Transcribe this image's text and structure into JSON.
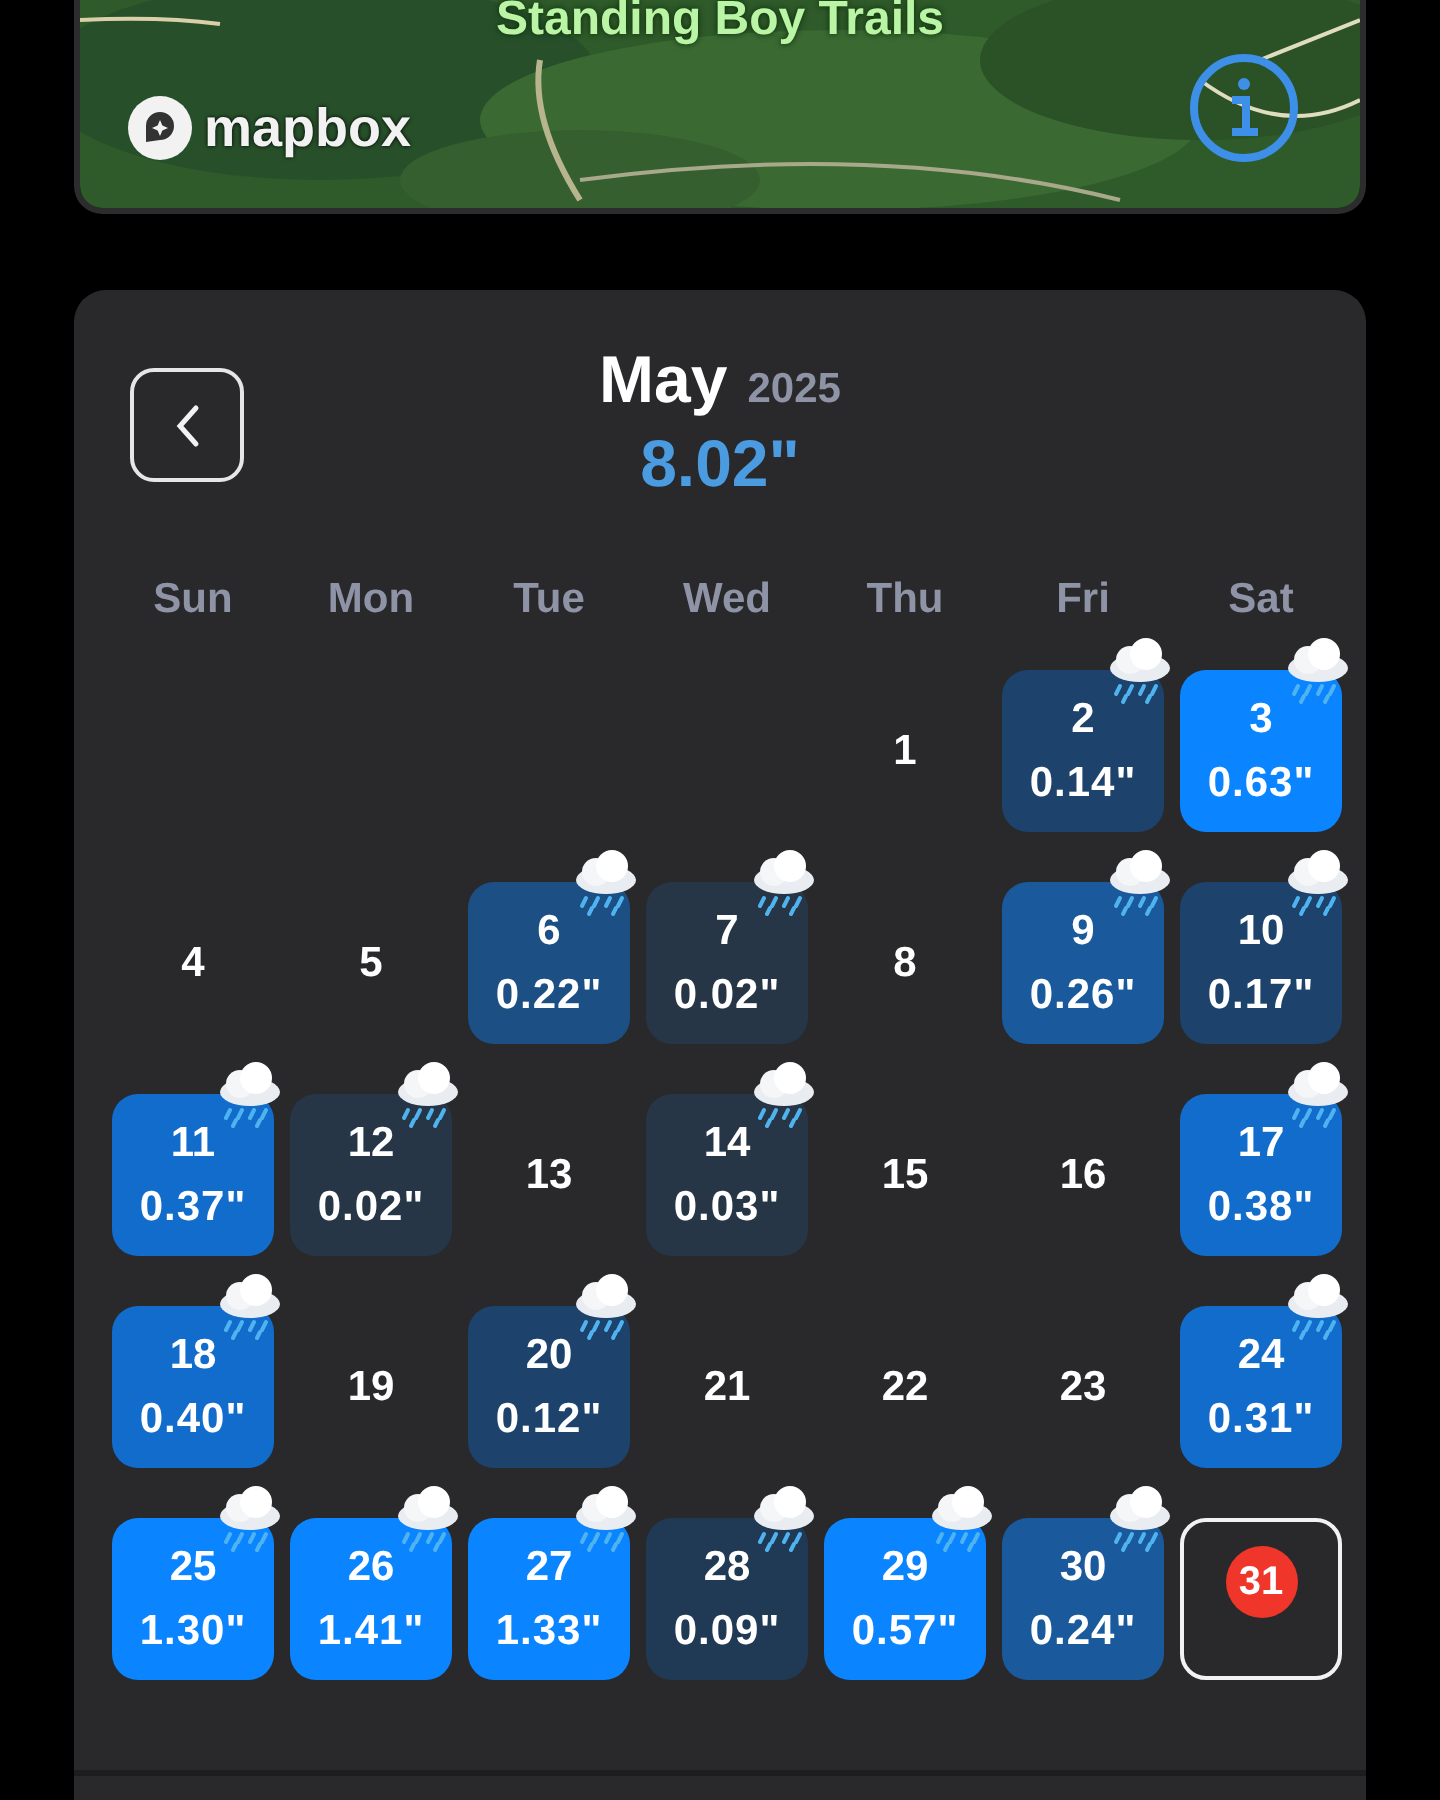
{
  "map": {
    "label": "Standing Boy Trails",
    "attribution": "mapbox"
  },
  "calendar": {
    "month": "May",
    "year": "2025",
    "total": "8.02\"",
    "weekdays": [
      "Sun",
      "Mon",
      "Tue",
      "Wed",
      "Thu",
      "Fri",
      "Sat"
    ],
    "days": [
      {
        "kind": "blank"
      },
      {
        "kind": "blank"
      },
      {
        "kind": "blank"
      },
      {
        "kind": "blank"
      },
      {
        "kind": "dry",
        "day": "1"
      },
      {
        "kind": "rain",
        "day": "2",
        "amount": "0.14\"",
        "color": "#1d426b"
      },
      {
        "kind": "rain",
        "day": "3",
        "amount": "0.63\"",
        "color": "#0a84ff"
      },
      {
        "kind": "dry",
        "day": "4"
      },
      {
        "kind": "dry",
        "day": "5"
      },
      {
        "kind": "rain",
        "day": "6",
        "amount": "0.22\"",
        "color": "#1c4f84"
      },
      {
        "kind": "rain",
        "day": "7",
        "amount": "0.02\"",
        "color": "#263646"
      },
      {
        "kind": "dry",
        "day": "8"
      },
      {
        "kind": "rain",
        "day": "9",
        "amount": "0.26\"",
        "color": "#1a5a9c"
      },
      {
        "kind": "rain",
        "day": "10",
        "amount": "0.17\"",
        "color": "#1d426b"
      },
      {
        "kind": "rain",
        "day": "11",
        "amount": "0.37\"",
        "color": "#116ccc"
      },
      {
        "kind": "rain",
        "day": "12",
        "amount": "0.02\"",
        "color": "#263646"
      },
      {
        "kind": "dry",
        "day": "13"
      },
      {
        "kind": "rain",
        "day": "14",
        "amount": "0.03\"",
        "color": "#263646"
      },
      {
        "kind": "dry",
        "day": "15"
      },
      {
        "kind": "dry",
        "day": "16"
      },
      {
        "kind": "rain",
        "day": "17",
        "amount": "0.38\"",
        "color": "#116ccc"
      },
      {
        "kind": "rain",
        "day": "18",
        "amount": "0.40\"",
        "color": "#116ccc"
      },
      {
        "kind": "dry",
        "day": "19"
      },
      {
        "kind": "rain",
        "day": "20",
        "amount": "0.12\"",
        "color": "#1d426b"
      },
      {
        "kind": "dry",
        "day": "21"
      },
      {
        "kind": "dry",
        "day": "22"
      },
      {
        "kind": "dry",
        "day": "23"
      },
      {
        "kind": "rain",
        "day": "24",
        "amount": "0.31\"",
        "color": "#116ccc"
      },
      {
        "kind": "rain",
        "day": "25",
        "amount": "1.30\"",
        "color": "#0a84ff"
      },
      {
        "kind": "rain",
        "day": "26",
        "amount": "1.41\"",
        "color": "#0a84ff"
      },
      {
        "kind": "rain",
        "day": "27",
        "amount": "1.33\"",
        "color": "#0a84ff"
      },
      {
        "kind": "rain",
        "day": "28",
        "amount": "0.09\"",
        "color": "#203a55"
      },
      {
        "kind": "rain",
        "day": "29",
        "amount": "0.57\"",
        "color": "#0a84ff"
      },
      {
        "kind": "rain",
        "day": "30",
        "amount": "0.24\"",
        "color": "#1a5a9c"
      },
      {
        "kind": "today",
        "day": "31"
      }
    ]
  }
}
